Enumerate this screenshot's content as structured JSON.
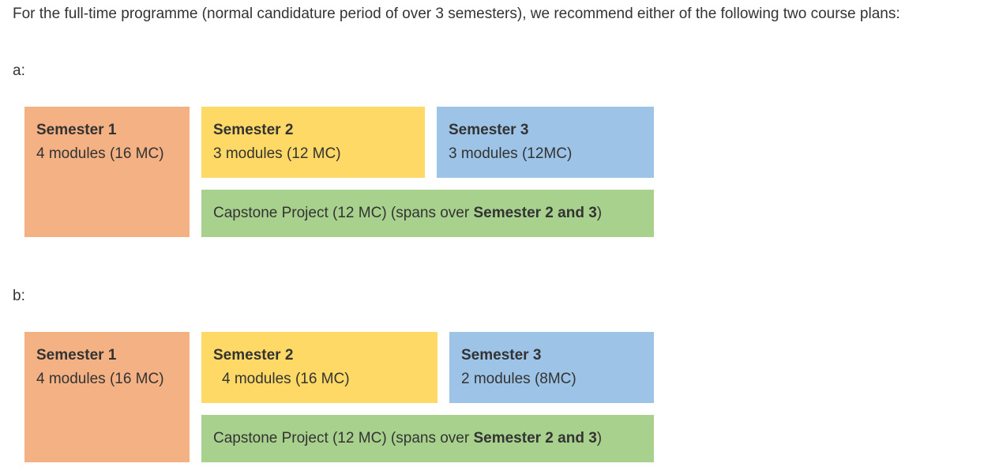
{
  "intro": "For the full-time programme (normal candidature period of over 3 semesters), we recommend either of the following two course plans:",
  "plans": [
    {
      "label": "a:",
      "sem1": {
        "title": "Semester 1",
        "detail": "4 modules (16 MC)"
      },
      "sem2": {
        "title": "Semester 2",
        "detail": "3 modules (12 MC)"
      },
      "sem3": {
        "title": "Semester 3",
        "detail": "3 modules (12MC)"
      },
      "capstone": {
        "prefix": "Capstone Project (12 MC) (spans over ",
        "bold": "Semester 2 and 3",
        "suffix": ")"
      }
    },
    {
      "label": "b:",
      "sem1": {
        "title": "Semester 1",
        "detail": "4 modules (16 MC)"
      },
      "sem2": {
        "title": "Semester 2",
        "detail": "4 modules (16 MC)"
      },
      "sem3": {
        "title": "Semester 3",
        "detail": "2 modules (8MC)"
      },
      "capstone": {
        "prefix": "Capstone Project (12 MC) (spans over ",
        "bold": "Semester 2 and 3",
        "suffix": ")"
      }
    }
  ],
  "colors": {
    "semester_1": "#f4b183",
    "semester_2": "#ffd966",
    "semester_3": "#9dc3e6",
    "capstone": "#a9d18e",
    "text": "#333333"
  }
}
